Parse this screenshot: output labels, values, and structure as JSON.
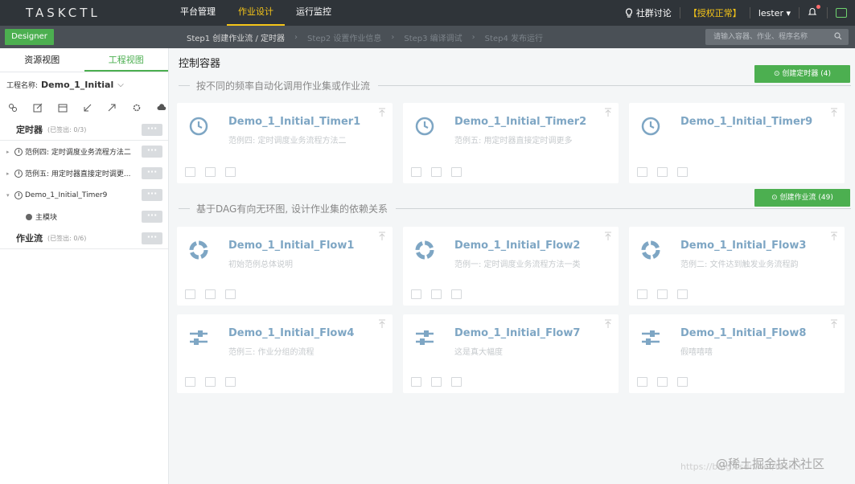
{
  "topbar": {
    "logo": "TASKCTL",
    "nav": [
      "平台管理",
      "作业设计",
      "运行监控"
    ],
    "community": "社群讨论",
    "license": "【授权正常】",
    "user": "lester ▾"
  },
  "stepbar": {
    "designer": "Designer",
    "steps": [
      "Step1 创建作业流 / 定时器",
      "Step2 设置作业信息",
      "Step3 编译调试",
      "Step4 发布运行"
    ],
    "search_placeholder": "请输入容器、作业、程序名称"
  },
  "sidebar": {
    "tabs": [
      "资源视图",
      "工程视图"
    ],
    "project_label": "工程名称:",
    "project_name": "Demo_1_Initial",
    "timer_group": {
      "label": "定时器",
      "count": "(已签出: 0/3)"
    },
    "timers": [
      "范例四: 定时调度业务流程方法二",
      "范例五: 用定时器直接定时调更...",
      "Demo_1_Initial_Timer9"
    ],
    "module": "主模块",
    "flow_group": {
      "label": "作业流",
      "count": "(已签出: 0/6)"
    },
    "more": "···"
  },
  "main": {
    "title": "控制容器",
    "timer_section": "按不同的频率自动化调用作业集或作业流",
    "timer_button": "⊙ 创建定时器 (4)",
    "flow_section": "基于DAG有向无环图, 设计作业集的依赖关系",
    "flow_button": "⊙ 创建作业流 (49)",
    "timers": [
      {
        "name": "Demo_1_Initial_Timer1",
        "desc": "范例四: 定时调度业务流程方法二"
      },
      {
        "name": "Demo_1_Initial_Timer2",
        "desc": "范例五: 用定时器直接定时调更多"
      },
      {
        "name": "Demo_1_Initial_Timer9",
        "desc": ""
      }
    ],
    "flows": [
      {
        "name": "Demo_1_Initial_Flow1",
        "desc": "初始范例总体说明"
      },
      {
        "name": "Demo_1_Initial_Flow2",
        "desc": "范例一: 定时调度业务流程方法一类"
      },
      {
        "name": "Demo_1_Initial_Flow3",
        "desc": "范例二: 文件达到触发业务流程韵"
      },
      {
        "name": "Demo_1_Initial_Flow4",
        "desc": "范例三: 作业分组的流程"
      },
      {
        "name": "Demo_1_Initial_Flow7",
        "desc": "这是真大幅度"
      },
      {
        "name": "Demo_1_Initial_Flow8",
        "desc": "假嘻嘻嘻"
      }
    ]
  },
  "watermark": {
    "url": "https://blog.csdn.net/taskctl",
    "brand": "@稀土掘金技术社区"
  }
}
